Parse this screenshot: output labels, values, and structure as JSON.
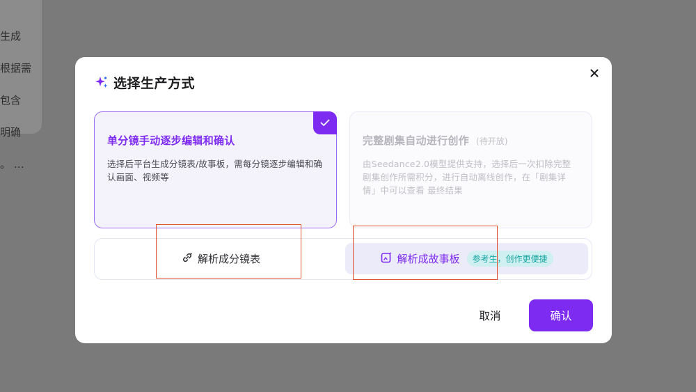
{
  "background": {
    "lines": [
      "生成",
      "根据需",
      "包含",
      "明确",
      "。 …"
    ]
  },
  "modal": {
    "title": "选择生产方式",
    "icons": {
      "title": "sparkle-icon",
      "close": "close-icon"
    }
  },
  "options": [
    {
      "title": "单分镜手动逐步编辑和确认",
      "tag": "",
      "description": "选择后平台生成分镜表/故事板，需每分镜逐步编辑和确认画面、视频等",
      "selected": true
    },
    {
      "title": "完整剧集自动进行创作",
      "tag": "(待开放)",
      "description": "由Seedance2.0模型提供支持，选择后一次扣除完整剧集创作所需积分，进行自动离线创作，在「剧集详情」中可以查看 最终结果",
      "selected": false
    }
  ],
  "parse": {
    "storyboard_table": {
      "label": "解析成分镜表",
      "icon": "link-spark-icon"
    },
    "storyboard_board": {
      "label": "解析成故事板",
      "icon": "board-spark-icon",
      "badge": "参考生，创作更便捷"
    }
  },
  "footer": {
    "cancel_label": "取消",
    "confirm_label": "确认"
  },
  "colors": {
    "accent": "#7d2bf0",
    "annotation_box": "#e0512d",
    "badge_bg": "#cfeff0",
    "badge_text": "#17a6a2"
  }
}
